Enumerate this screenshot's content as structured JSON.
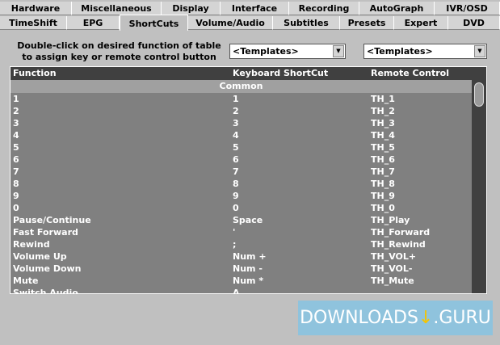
{
  "tabs_row1": [
    "Hardware",
    "Miscellaneous",
    "Display",
    "Interface",
    "Recording",
    "AutoGraph",
    "IVR/OSD"
  ],
  "tabs_row2": [
    "TimeShift",
    "EPG",
    "ShortCuts",
    "Volume/Audio",
    "Subtitles",
    "Presets",
    "Expert",
    "DVD"
  ],
  "active_tab": "ShortCuts",
  "instruction": "Double-click on desired function of table to assign key or remote control button",
  "keyboard_template": "<Templates>",
  "remote_template": "<Templates>",
  "table": {
    "headers": [
      "Function",
      "Keyboard ShortCut",
      "Remote Control"
    ],
    "group": "Common",
    "rows": [
      [
        "1",
        "1",
        "TH_1"
      ],
      [
        "2",
        "2",
        "TH_2"
      ],
      [
        "3",
        "3",
        "TH_3"
      ],
      [
        "4",
        "4",
        "TH_4"
      ],
      [
        "5",
        "5",
        "TH_5"
      ],
      [
        "6",
        "6",
        "TH_6"
      ],
      [
        "7",
        "7",
        "TH_7"
      ],
      [
        "8",
        "8",
        "TH_8"
      ],
      [
        "9",
        "9",
        "TH_9"
      ],
      [
        "0",
        "0",
        "TH_0"
      ],
      [
        "Pause/Continue",
        "Space",
        "TH_Play"
      ],
      [
        "Fast Forward",
        "'",
        "TH_Forward"
      ],
      [
        "Rewind",
        ";",
        "TH_Rewind"
      ],
      [
        "Volume Up",
        "Num +",
        "TH_VOL+"
      ],
      [
        "Volume Down",
        "Num -",
        "TH_VOL-"
      ],
      [
        "Mute",
        "Num *",
        "TH_Mute"
      ],
      [
        "Switch Audio",
        "A",
        ""
      ]
    ]
  },
  "watermark": "DOWNLOADS .GURU"
}
